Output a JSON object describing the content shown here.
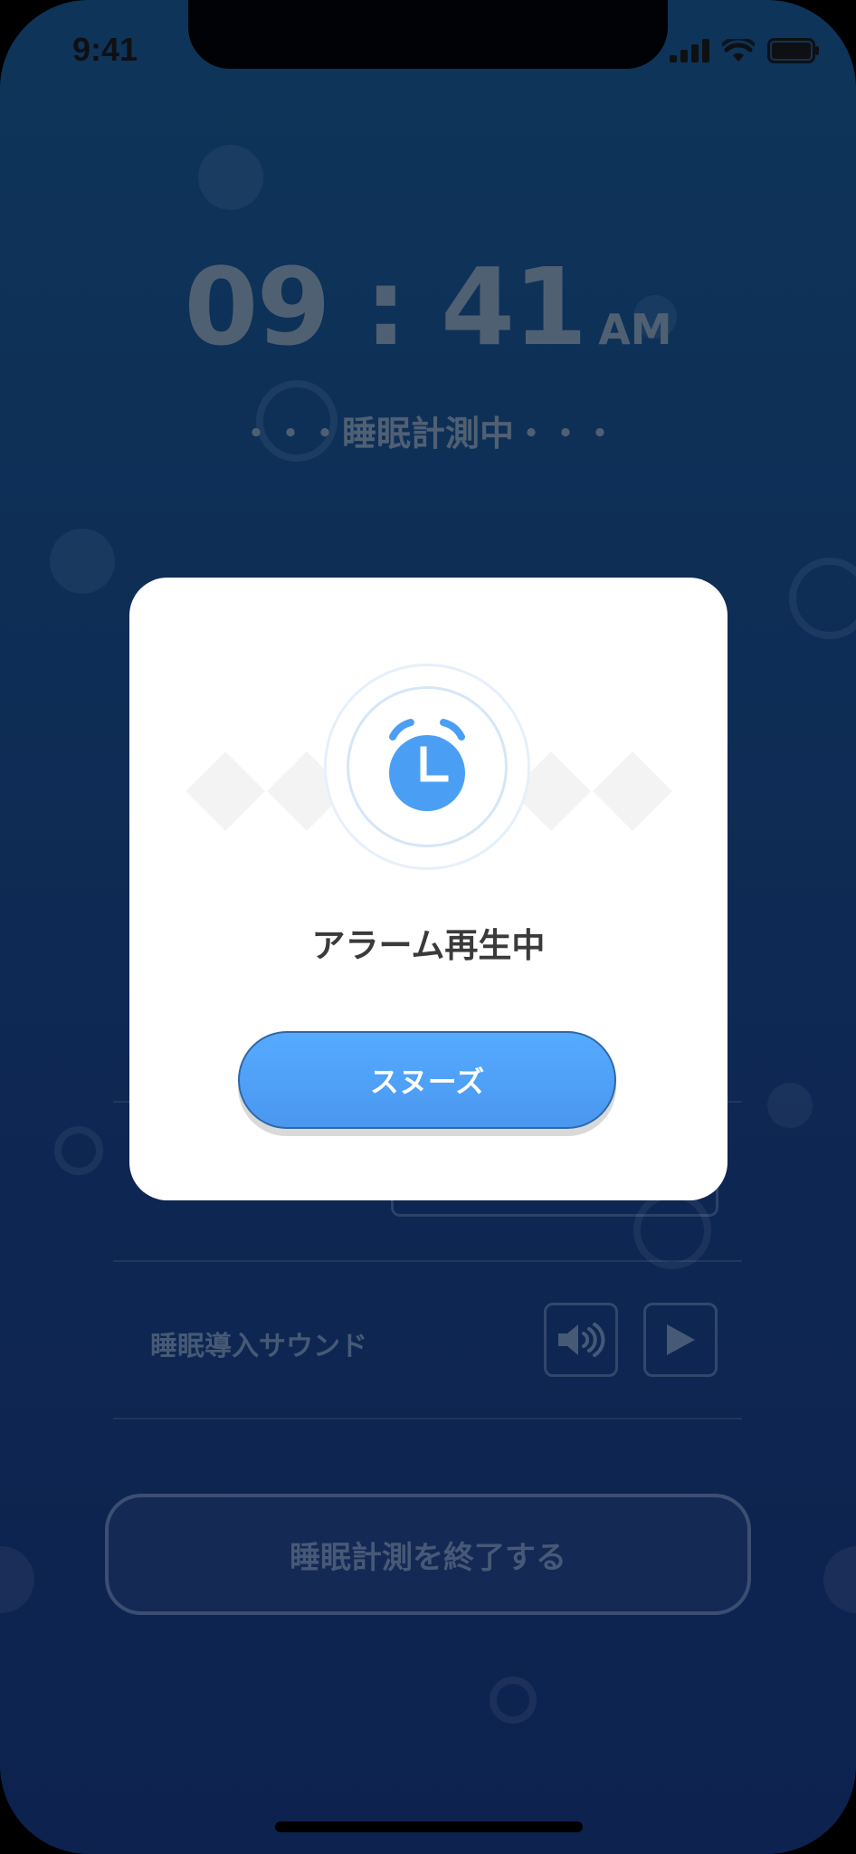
{
  "status_bar": {
    "time": "9:41"
  },
  "clock": {
    "digits": "09 : 41",
    "ampm": "AM"
  },
  "measuring_status": "・・・睡眠計測中・・・",
  "settings": {
    "sleep_sound_label": "睡眠導入サウンド",
    "volume_icon": "speaker-icon",
    "play_icon": "play-icon"
  },
  "end_button_label": "睡眠計測を終了する",
  "alarm_modal": {
    "icon": "alarm-clock-icon",
    "title": "アラーム再生中",
    "snooze_label": "スヌーズ"
  },
  "colors": {
    "accent": "#4a9ff5",
    "background_top": "#0f3a60",
    "background_bottom": "#0e2555"
  }
}
